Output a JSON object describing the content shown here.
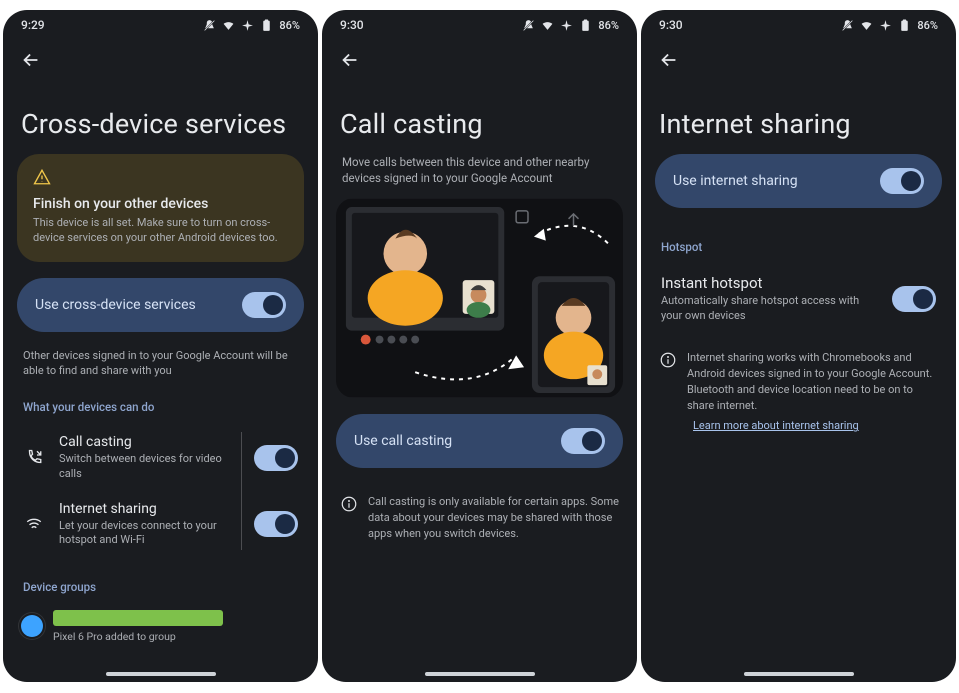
{
  "screens": [
    {
      "time": "9:29",
      "battery": "86%",
      "title": "Cross-device services",
      "warning": {
        "heading": "Finish on your other devices",
        "body": "This device is all set. Make sure to turn on cross-device services on your other Android devices too."
      },
      "main_toggle_label": "Use cross-device services",
      "helper": "Other devices signed in to your Google Account will be able to find and share with you",
      "section1_label": "What your devices can do",
      "items": [
        {
          "title": "Call casting",
          "desc": "Switch between devices for video calls"
        },
        {
          "title": "Internet sharing",
          "desc": "Let your devices connect to your hotspot and Wi-Fi"
        }
      ],
      "section2_label": "Device groups",
      "group_device": "Pixel 6 Pro added to group"
    },
    {
      "time": "9:30",
      "battery": "86%",
      "title": "Call casting",
      "subhead": "Move calls between this device and other nearby devices signed in to your Google Account",
      "main_toggle_label": "Use call casting",
      "info": "Call casting is only available for certain apps. Some data about your devices may be shared with those apps when you switch devices."
    },
    {
      "time": "9:30",
      "battery": "86%",
      "title": "Internet sharing",
      "main_toggle_label": "Use internet sharing",
      "section1_label": "Hotspot",
      "item": {
        "title": "Instant hotspot",
        "desc": "Automatically share hotspot access with your own devices"
      },
      "info": "Internet sharing works with Chromebooks and Android devices signed in to your Google Account. Bluetooth and device location need to be on to share internet.",
      "link": "Learn more about internet sharing"
    }
  ]
}
